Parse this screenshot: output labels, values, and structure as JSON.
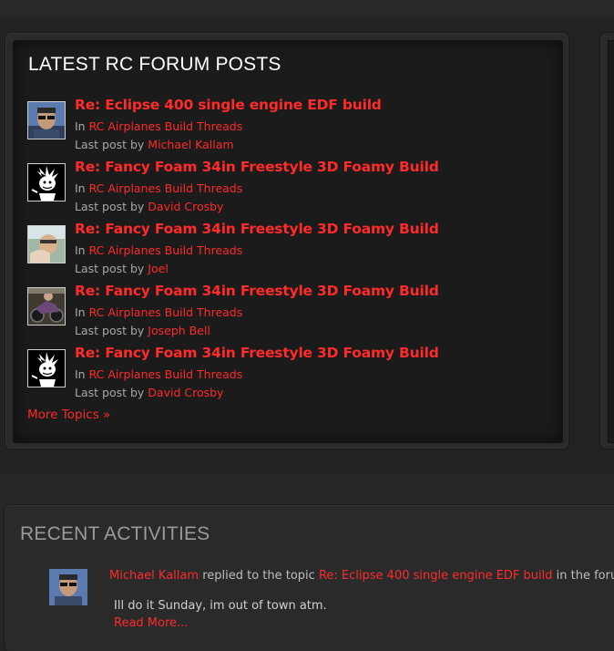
{
  "latest_posts": {
    "title": "LATEST RC FORUM POSTS",
    "in_label": "In",
    "last_post_label": "Last post by",
    "items": [
      {
        "title": "Re: Eclipse 400 single engine EDF build",
        "forum": "RC Airplanes Build Threads",
        "author": "Michael Kallam",
        "avatar": "man-sunglasses-avatar"
      },
      {
        "title": "Re: Fancy Foam 34in Freestyle 3D Foamy Build",
        "forum": "RC Airplanes Build Threads",
        "author": "David Crosby",
        "avatar": "cartoon-character-avatar"
      },
      {
        "title": "Re: Fancy Foam 34in Freestyle 3D Foamy Build",
        "forum": "RC Airplanes Build Threads",
        "author": "Joel",
        "avatar": "man-photo-avatar"
      },
      {
        "title": "Re: Fancy Foam 34in Freestyle 3D Foamy Build",
        "forum": "RC Airplanes Build Threads",
        "author": "Joseph Bell",
        "avatar": "motorcycle-photo-avatar"
      },
      {
        "title": "Re: Fancy Foam 34in Freestyle 3D Foamy Build",
        "forum": "RC Airplanes Build Threads",
        "author": "David Crosby",
        "avatar": "cartoon-character-avatar"
      }
    ],
    "more_label": "More Topics »"
  },
  "recent_activities": {
    "title": "RECENT ACTIVITIES",
    "actor": "Michael Kallam",
    "action_text": "replied to the topic",
    "topic": "Re: Eclipse 400 single engine EDF build",
    "suffix_text": "in the forum",
    "quote": "Ill do it Sunday, im out of town atm.",
    "read_more": "Read More..."
  },
  "colors": {
    "accent": "#ff2a2a",
    "background": "#1b1b1b",
    "muted_text": "#a8a8a8"
  }
}
